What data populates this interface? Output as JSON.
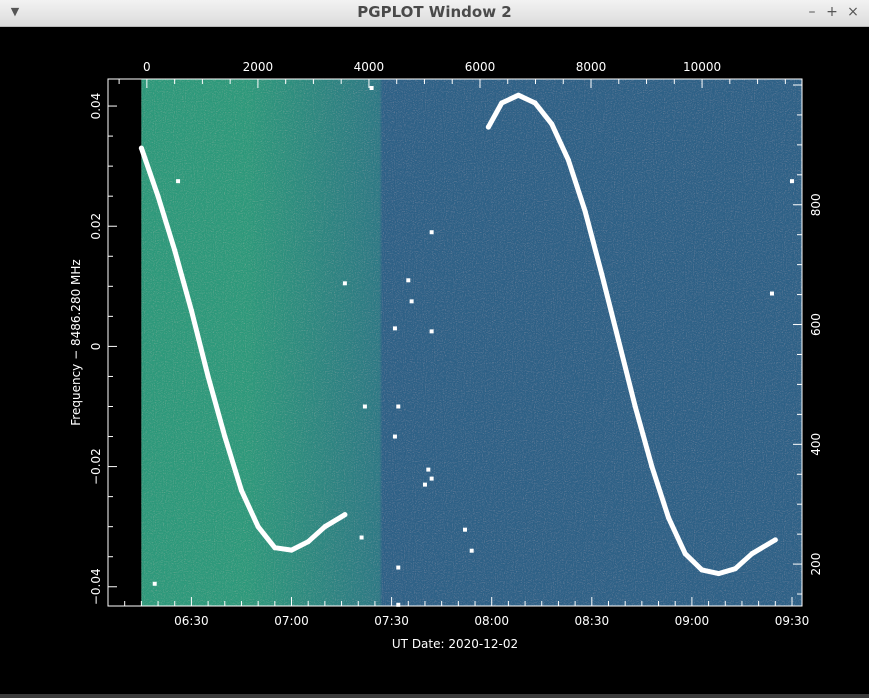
{
  "window": {
    "title": "PGPLOT Window 2",
    "menu_icon": "chevron-down-icon",
    "minimize_label": "–",
    "maximize_label": "+",
    "close_label": "×"
  },
  "colors": {
    "background": "#000000",
    "frame": "#ffffff",
    "track": "#ffffff",
    "image_early": "#2e9a7c",
    "image_mid": "#2e7a86",
    "image_late": "#2f6288"
  },
  "chart_data": {
    "type": "scatter",
    "title": "",
    "xlabel": "UT Date: 2020-12-02",
    "ylabel": "Frequency − 8486.280  MHz",
    "xlim": [
      "06:05",
      "09:33"
    ],
    "ylim": [
      -0.0432,
      0.0445
    ],
    "x_ticks": [
      "06:30",
      "07:00",
      "07:30",
      "08:00",
      "08:30",
      "09:00",
      "09:30"
    ],
    "y_ticks": [
      "0.04",
      "0.02",
      "0",
      "−0.02",
      "−0.04"
    ],
    "top_axis": {
      "label": "",
      "range": [
        -700,
        11800
      ],
      "ticks": [
        "0",
        "2000",
        "4000",
        "6000",
        "8000",
        "10000"
      ]
    },
    "right_axis": {
      "label": "",
      "range": [
        130,
        1010
      ],
      "ticks": [
        "200",
        "400",
        "600",
        "800"
      ]
    },
    "background": "waterfall spectrogram image",
    "grid": false,
    "legend": "none",
    "series": [
      {
        "points": [
          [
            "06:15",
            0.033
          ],
          [
            "06:20",
            0.025
          ],
          [
            "06:25",
            0.016
          ],
          [
            "06:30",
            0.006
          ],
          [
            "06:35",
            -0.005
          ],
          [
            "06:40",
            -0.015
          ],
          [
            "06:45",
            -0.024
          ],
          [
            "06:50",
            -0.03
          ],
          [
            "06:55",
            -0.0335
          ],
          [
            "07:00",
            -0.0339
          ],
          [
            "07:05",
            -0.0325
          ],
          [
            "07:10",
            -0.03
          ],
          [
            "07:16",
            -0.028
          ]
        ]
      },
      {
        "points": [
          [
            "07:59",
            0.0365
          ],
          [
            "08:03",
            0.0405
          ],
          [
            "08:08",
            0.0418
          ],
          [
            "08:13",
            0.0405
          ],
          [
            "08:18",
            0.037
          ],
          [
            "08:23",
            0.031
          ],
          [
            "08:28",
            0.0225
          ],
          [
            "08:33",
            0.012
          ],
          [
            "08:38",
            0.001
          ],
          [
            "08:43",
            -0.01
          ],
          [
            "08:48",
            -0.02
          ],
          [
            "08:53",
            -0.0285
          ],
          [
            "08:58",
            -0.0345
          ],
          [
            "09:03",
            -0.0372
          ],
          [
            "09:08",
            -0.0378
          ],
          [
            "09:13",
            -0.037
          ],
          [
            "09:18",
            -0.0345
          ],
          [
            "09:25",
            -0.0322
          ]
        ]
      },
      {
        "points": [
          [
            "06:19",
            -0.0395
          ],
          [
            "06:26",
            0.0275
          ],
          [
            "07:16",
            0.0105
          ],
          [
            "07:21",
            -0.0318
          ],
          [
            "07:22",
            -0.01
          ],
          [
            "07:24",
            0.043
          ],
          [
            "07:31",
            0.003
          ],
          [
            "07:31",
            -0.015
          ],
          [
            "07:32",
            -0.01
          ],
          [
            "07:32",
            -0.0368
          ],
          [
            "07:32",
            -0.043
          ],
          [
            "07:35",
            0.011
          ],
          [
            "07:36",
            0.0075
          ],
          [
            "07:40",
            -0.023
          ],
          [
            "07:41",
            -0.0205
          ],
          [
            "07:42",
            0.0025
          ],
          [
            "07:42",
            0.019
          ],
          [
            "07:42",
            -0.022
          ],
          [
            "07:52",
            -0.0305
          ],
          [
            "07:54",
            -0.034
          ],
          [
            "09:24",
            0.0088
          ],
          [
            "09:30",
            0.0275
          ]
        ]
      }
    ]
  }
}
